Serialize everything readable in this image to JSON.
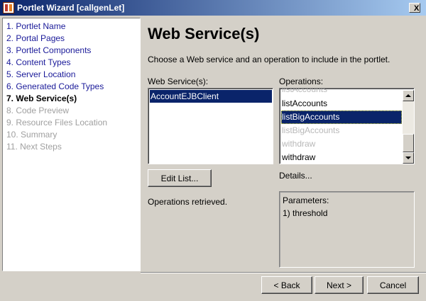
{
  "window": {
    "title": "Portlet Wizard [callgenLet]",
    "close_label": "X"
  },
  "steps": [
    {
      "label": "1. Portlet Name",
      "state": "done"
    },
    {
      "label": "2. Portal Pages",
      "state": "done"
    },
    {
      "label": "3. Portlet Components",
      "state": "done"
    },
    {
      "label": "4. Content Types",
      "state": "done"
    },
    {
      "label": "5. Server Location",
      "state": "done"
    },
    {
      "label": "6. Generated Code Types",
      "state": "done"
    },
    {
      "label": "7. Web Service(s)",
      "state": "current"
    },
    {
      "label": "8. Code Preview",
      "state": "todo"
    },
    {
      "label": "9. Resource Files Location",
      "state": "todo"
    },
    {
      "label": "10. Summary",
      "state": "todo"
    },
    {
      "label": "11. Next Steps",
      "state": "todo"
    }
  ],
  "main": {
    "title": "Web Service(s)",
    "description": "Choose a Web service and an operation to include in the portlet.",
    "web_services_label": "Web Service(s):",
    "web_services": [
      "AccountEJBClient"
    ],
    "operations_label": "Operations:",
    "operations": [
      {
        "label": "listAccounts",
        "state": "dim"
      },
      {
        "label": "listAccounts",
        "state": "normal"
      },
      {
        "label": "listBigAccounts",
        "state": "selected"
      },
      {
        "label": "listBigAccounts",
        "state": "dim"
      },
      {
        "label": "withdraw",
        "state": "dim"
      },
      {
        "label": "withdraw",
        "state": "normal"
      }
    ],
    "edit_list_label": "Edit List...",
    "details_label": "Details...",
    "status": "Operations retrieved.",
    "details": {
      "heading": "Parameters:",
      "params": [
        "1) threshold"
      ]
    }
  },
  "buttons": {
    "back": "< Back",
    "next": "Next >",
    "cancel": "Cancel"
  },
  "colors": {
    "selection": "#0a246a",
    "link_step": "#1a1a99",
    "disabled_step": "#a0a0a0",
    "face": "#d4d0c8"
  }
}
